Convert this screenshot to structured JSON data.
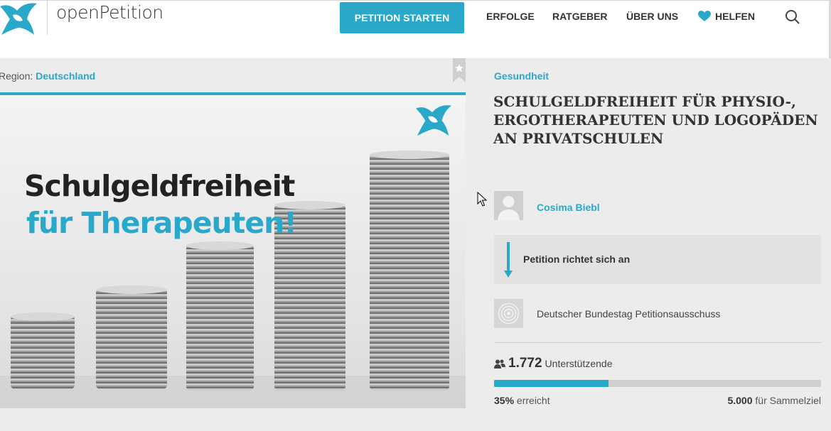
{
  "header": {
    "logo_text": "openPetition",
    "start_button": "PETITION STARTEN",
    "nav": [
      {
        "label": "ERFOLGE"
      },
      {
        "label": "RATGEBER"
      },
      {
        "label": "ÜBER UNS"
      },
      {
        "label": "HELFEN",
        "icon": "heart-icon"
      }
    ],
    "search_icon": "search-icon"
  },
  "petition": {
    "region_label": "Region:",
    "region_value": "Deutschland",
    "hero_line1": "Schulgeldfreiheit",
    "hero_line2": "für Therapeuten!",
    "category": "Gesundheit",
    "title": "SCHULGELDFREIHEIT FÜR PHYSIO-, ERGOTHERAPEUTEN UND LOGOPÄDEN AN PRIVATSCHULEN",
    "author": "Cosima Biebl",
    "addressee_label": "Petition richtet sich an",
    "recipient": "Deutscher Bundestag Petitionsausschuss",
    "supporters_count": "1.772",
    "supporters_label": "Unterstützende",
    "progress_percent": 35,
    "reached_value": "35%",
    "reached_label": "erreicht",
    "goal_value": "5.000",
    "goal_label": "für Sammelziel"
  },
  "colors": {
    "accent": "#2aa8c9",
    "background": "#ececec",
    "text": "#333333"
  }
}
